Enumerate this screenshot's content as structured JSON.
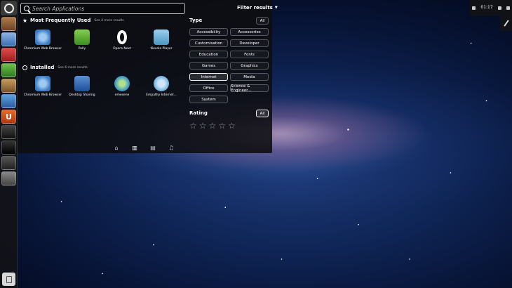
{
  "search": {
    "placeholder": "Search Applications"
  },
  "most_frequent": {
    "title": "Most Frequently Used",
    "more": "See 4 more results",
    "apps": [
      {
        "label": "Chromium Web Browser",
        "icon": "chromium-icon"
      },
      {
        "label": "Polly",
        "icon": "polly-icon"
      },
      {
        "label": "Opera Next",
        "icon": "opera-icon"
      },
      {
        "label": "Nuvola Player",
        "icon": "nuvola-icon"
      }
    ]
  },
  "installed": {
    "title": "Installed",
    "more": "See 6 more results",
    "apps": [
      {
        "label": "Chromium Web Browser",
        "icon": "chromium-icon"
      },
      {
        "label": "Desktop Sharing",
        "icon": "desktop-sharing-icon"
      },
      {
        "label": "emesene",
        "icon": "emesene-icon"
      },
      {
        "label": "Empathy Internet...",
        "icon": "empathy-icon"
      }
    ]
  },
  "filter": {
    "title": "Filter results",
    "type_label": "Type",
    "all_label": "All",
    "types": [
      "Accessibility",
      "Accessories",
      "Customisation",
      "Developer",
      "Education",
      "Fonts",
      "Games",
      "Graphics",
      "Internet",
      "Media",
      "Office",
      "Science & Engineer...",
      "System"
    ],
    "selected_type": "Internet",
    "rating_label": "Rating",
    "rating_all_label": "All",
    "rating_value": 0,
    "rating_max": 5
  },
  "lenses": [
    "home-icon",
    "applications-icon",
    "files-icon",
    "music-icon"
  ],
  "active_lens": "applications-icon",
  "top_panel": {
    "clock": "01:17"
  },
  "colors": {
    "selected_border": "#ffffff",
    "dash_bg": "#0e0e10"
  }
}
